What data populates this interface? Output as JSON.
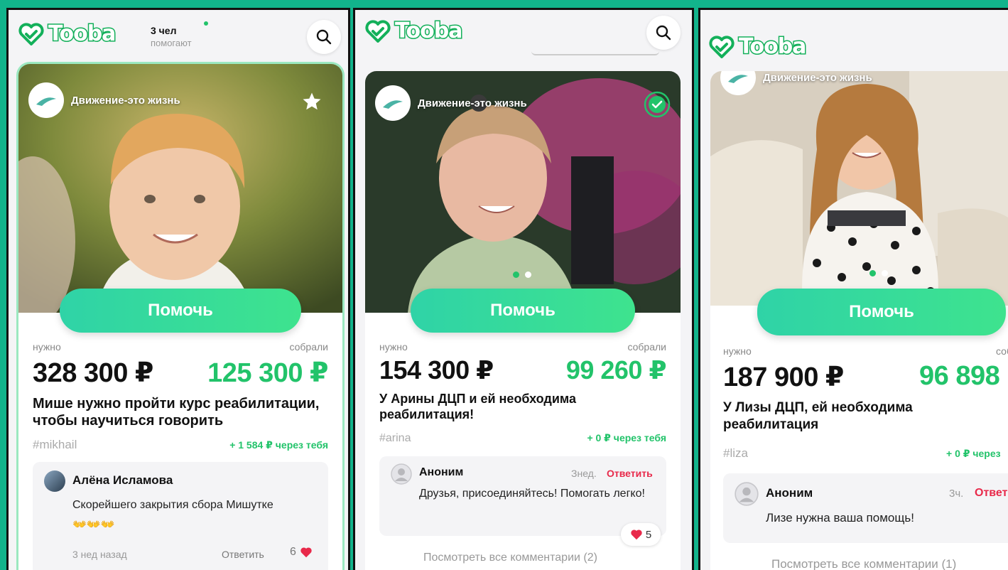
{
  "brand": {
    "name": "Tooba",
    "accent": "#22c36a",
    "background": "#12b48c"
  },
  "panels": [
    {
      "header": {
        "helpers_count": "3 чел",
        "helpers_label": "помогают",
        "search_icon": "search-icon"
      },
      "card": {
        "org_name": "Движение-это жизнь",
        "corner_icon": "star-icon",
        "help_label": "Помочь",
        "need_label": "нужно",
        "collected_label": "собрали",
        "need_amount": "328 300 ₽",
        "collected_amount": "125 300 ₽",
        "title": "Мише нужно пройти курс реабилитации, чтобы научиться говорить",
        "hashtag": "#mikhail",
        "via_you": "+ 1 584 ₽ через тебя",
        "comment": {
          "author": "Алёна Исламова",
          "text": "Скорейшего закрытия сбора Мишутке",
          "emoji": "👐👐👐",
          "time": "3 нед назад",
          "reply": "Ответить",
          "likes": "6"
        }
      }
    },
    {
      "header": {
        "search_icon": "search-icon"
      },
      "card": {
        "org_name": "Движение-это жизнь",
        "corner_icon": "check-circle-icon",
        "help_label": "Помочь",
        "need_label": "нужно",
        "collected_label": "собрали",
        "need_amount": "154 300 ₽",
        "collected_amount": "99 260 ₽",
        "title": "У Арины ДЦП и ей необходима реабилитация!",
        "hashtag": "#arina",
        "via_you": "+ 0 ₽ через тебя",
        "comment": {
          "author": "Аноним",
          "text": "Друзья, присоединяйтесь! Помогать легко!",
          "time": "Знед.",
          "reply": "Ответить",
          "likes": "5"
        },
        "view_all": "Посмотреть все комментарии (2)"
      }
    },
    {
      "header": {},
      "card": {
        "org_name": "Движение-это жизнь",
        "help_label": "Помочь",
        "need_label": "нужно",
        "collected_label": "соб",
        "need_amount": "187 900 ₽",
        "collected_amount": "96 898",
        "title": "У Лизы ДЦП, ей необходима реабилитация",
        "hashtag": "#liza",
        "via_you": "+ 0 ₽ через",
        "comment": {
          "author": "Аноним",
          "text": "Лизе нужна ваша помощь!",
          "time": "3ч.",
          "reply": "Ответ"
        },
        "view_all": "Посмотреть все комментарии (1)"
      }
    }
  ]
}
